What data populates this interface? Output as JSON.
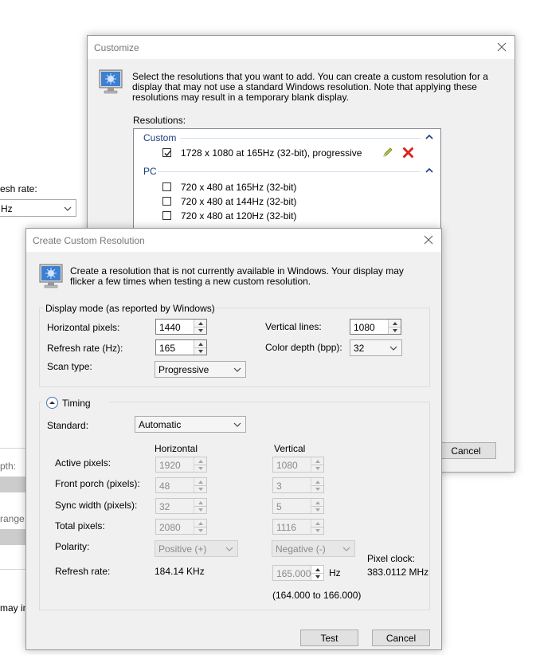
{
  "background_window": {
    "refresh_rate_label": "esh rate:",
    "refresh_rate_value": "Hz",
    "depth_label": "pth:",
    "range_label": "range",
    "may_text": "may in"
  },
  "customize": {
    "title": "Customize",
    "description": "Select the resolutions that you want to add. You can create a custom resolution for a display that may not use a standard Windows resolution. Note that applying these resolutions may result in a temporary blank display.",
    "resolutions_label": "Resolutions:",
    "groups": [
      {
        "name": "Custom",
        "items": [
          {
            "label": "1728 x 1080 at 165Hz (32-bit), progressive",
            "checked": true
          }
        ]
      },
      {
        "name": "PC",
        "items": [
          {
            "label": "720 x 480 at 165Hz (32-bit)",
            "checked": false
          },
          {
            "label": "720 x 480 at 144Hz (32-bit)",
            "checked": false
          },
          {
            "label": "720 x 480 at 120Hz (32-bit)",
            "checked": false
          }
        ]
      }
    ],
    "cancel_label": "Cancel"
  },
  "create_custom": {
    "title": "Create Custom Resolution",
    "description": "Create a resolution that is not currently available in Windows. Your display may flicker a few times when testing a new custom resolution.",
    "display_mode": {
      "legend": "Display mode (as reported by Windows)",
      "horizontal_pixels_label": "Horizontal pixels:",
      "horizontal_pixels_value": "1440",
      "vertical_lines_label": "Vertical lines:",
      "vertical_lines_value": "1080",
      "refresh_rate_label": "Refresh rate (Hz):",
      "refresh_rate_value": "165",
      "color_depth_label": "Color depth (bpp):",
      "color_depth_value": "32",
      "scan_type_label": "Scan type:",
      "scan_type_value": "Progressive"
    },
    "timing": {
      "legend": "Timing",
      "standard_label": "Standard:",
      "standard_value": "Automatic",
      "horizontal_header": "Horizontal",
      "vertical_header": "Vertical",
      "rows": [
        {
          "label": "Active pixels:",
          "horizontal": "1920",
          "vertical": "1080"
        },
        {
          "label": "Front porch (pixels):",
          "horizontal": "48",
          "vertical": "3"
        },
        {
          "label": "Sync width (pixels):",
          "horizontal": "32",
          "vertical": "5"
        },
        {
          "label": "Total pixels:",
          "horizontal": "2080",
          "vertical": "1116"
        }
      ],
      "polarity_label": "Polarity:",
      "polarity_horizontal": "Positive (+)",
      "polarity_vertical": "Negative (-)",
      "refresh_rate_label": "Refresh rate:",
      "refresh_rate_horizontal": "184.14 KHz",
      "refresh_rate_vertical": "165.000",
      "refresh_rate_unit": "Hz",
      "refresh_range": "(164.000 to 166.000)",
      "pixel_clock_label": "Pixel clock:",
      "pixel_clock_value": "383.0112 MHz"
    },
    "test_label": "Test",
    "cancel_label": "Cancel"
  }
}
